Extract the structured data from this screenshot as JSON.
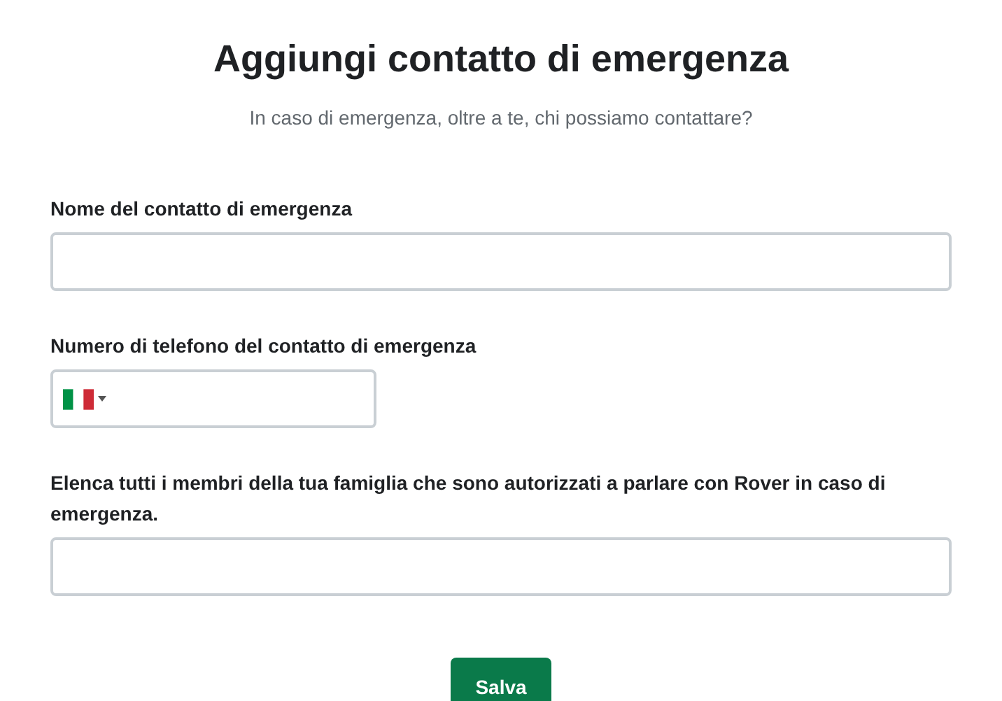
{
  "title": "Aggiungi contatto di emergenza",
  "subtitle": "In caso di emergenza, oltre a te, chi possiamo contattare?",
  "fields": [
    {
      "kind": "text",
      "label": "Nome del contatto di emergenza"
    },
    {
      "kind": "phone",
      "label": "Numero di telefono del contatto di emergenza"
    },
    {
      "kind": "text",
      "label": "Elenca tutti i membri della tua famiglia che sono autorizzati a parlare con Rover in caso di emergenza."
    }
  ],
  "button": "Salva"
}
